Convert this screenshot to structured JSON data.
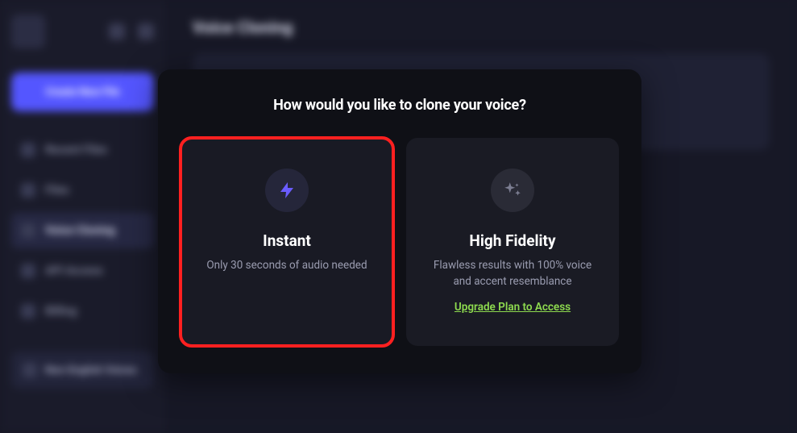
{
  "header": {
    "page_title": "Voice Cloning"
  },
  "sidebar": {
    "create_label": "Create New File",
    "items": [
      {
        "label": "Recent Files",
        "icon": "clock-icon",
        "active": false
      },
      {
        "label": "Files",
        "icon": "folder-icon",
        "active": false
      },
      {
        "label": "Voice Cloning",
        "icon": "wave-icon",
        "active": true
      },
      {
        "label": "API Access",
        "icon": "key-icon",
        "active": false
      },
      {
        "label": "Billing",
        "icon": "card-icon",
        "active": false
      }
    ],
    "nonenglish_label": "Non-English Voices"
  },
  "modal": {
    "title": "How would you like to clone your voice?",
    "cards": {
      "instant": {
        "title": "Instant",
        "desc": "Only 30 seconds of audio needed"
      },
      "highfidelity": {
        "title": "High Fidelity",
        "desc": "Flawless results with 100% voice and accent resemblance",
        "upgrade_label": "Upgrade Plan to Access"
      }
    }
  }
}
